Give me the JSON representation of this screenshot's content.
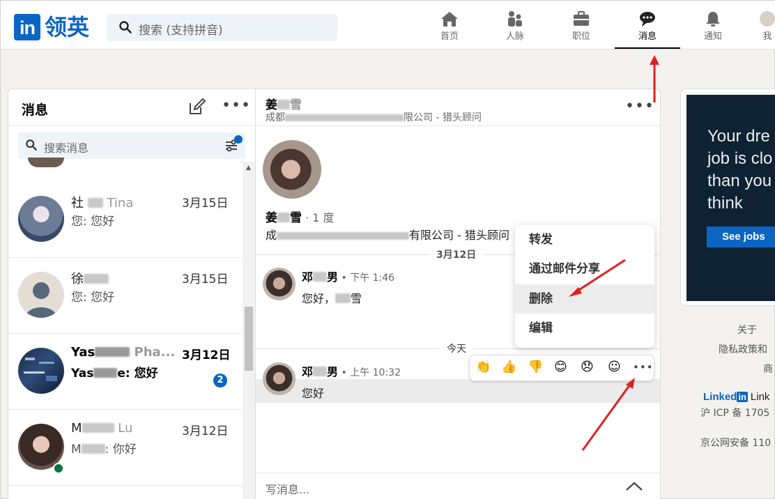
{
  "topbar": {
    "logo": "in",
    "brand": "领英",
    "search_placeholder": "搜索 (支持拼音)",
    "nav": [
      {
        "label": "首页",
        "icon": "home-icon"
      },
      {
        "label": "人脉",
        "icon": "network-icon"
      },
      {
        "label": "职位",
        "icon": "briefcase-icon"
      },
      {
        "label": "消息",
        "icon": "messaging-icon",
        "active": true
      },
      {
        "label": "通知",
        "icon": "bell-icon"
      },
      {
        "label": "我",
        "icon": "avatar-icon"
      }
    ]
  },
  "messaging": {
    "title": "消息",
    "more": "•••",
    "search_placeholder": "搜索消息",
    "conversations": [
      {
        "name": "社",
        "name_tail": "Tina",
        "preview": "您: 您好",
        "date": "3月15日"
      },
      {
        "name": "徐",
        "name_tail": "",
        "preview": "您: 您好",
        "date": "3月15日"
      },
      {
        "name": "Yas",
        "name_tail": "Pha...",
        "preview_prefix": "Yas",
        "preview": "e: 您好",
        "date": "3月12日",
        "unread_count": "2"
      },
      {
        "name": "M",
        "name_tail": "Lu",
        "preview_prefix": "M",
        "preview": ": 你好",
        "date": "3月12日"
      }
    ]
  },
  "thread": {
    "name": "姜",
    "name_tail": "雪",
    "subtitle_prefix": "成都",
    "subtitle_suffix": "限公司 - 猎头顾问",
    "more": "•••",
    "profile": {
      "name": "姜",
      "name_tail": "雪",
      "degree": " · 1 度",
      "company_prefix": "成",
      "company_suffix": "有限公司 - 猎头顾问"
    },
    "day1": "3月12日",
    "msg1": {
      "sender": "邓",
      "sender_tail": "男",
      "time": " • 下午 1:46",
      "text_prefix": "您好，",
      "text_tail": "雪"
    },
    "day2": "今天",
    "msg2": {
      "sender": "邓",
      "sender_tail": "男",
      "time": " • 上午 10:32",
      "text": "您好"
    },
    "reactions": [
      "👏",
      "👍",
      "👎",
      "😊",
      "😞",
      "☺",
      "•••"
    ],
    "menu": [
      {
        "label": "转发"
      },
      {
        "label": "通过邮件分享"
      },
      {
        "label": "删除",
        "highlight": true
      },
      {
        "label": "编辑"
      }
    ],
    "compose_placeholder": "写消息...",
    "accent_color": "#0a66c2"
  },
  "ad": {
    "lines": [
      "Your dre",
      "job is clo",
      "than you",
      "think"
    ],
    "button": "See jobs"
  },
  "footer": {
    "about": "关于",
    "privacy": "隐私政策和",
    "business": "商",
    "logo_text": "Linked",
    "logo_box": "in",
    "logo_rest": "Link",
    "icp": "沪 ICP 备 1705",
    "police": "京公网安备 110"
  }
}
